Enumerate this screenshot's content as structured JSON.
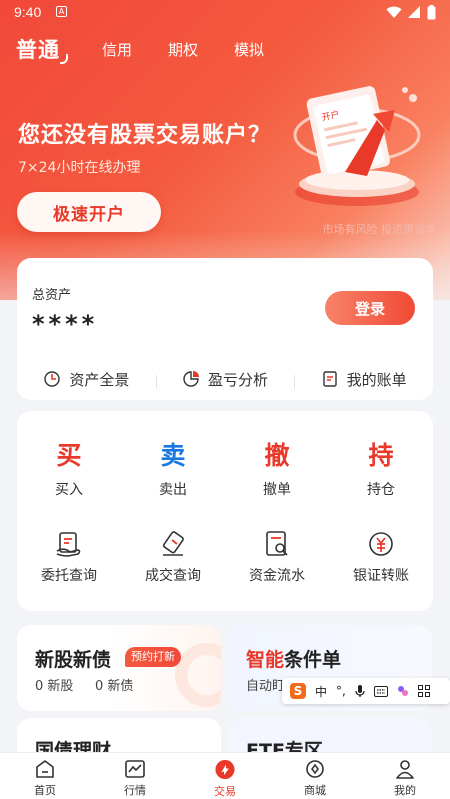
{
  "status_bar": {
    "time": "9:40",
    "notification_badge": "A"
  },
  "top_tabs": {
    "active": "普通",
    "others": [
      "信用",
      "期权",
      "模拟"
    ]
  },
  "hero": {
    "title": "您还没有股票交易账户？",
    "subtitle": "7×24小时在线办理",
    "open_button": "极速开户",
    "risk_note": "市场有风险 投资需谨慎",
    "illustration_text": "开户"
  },
  "asset_card": {
    "label": "总资产",
    "value": "****",
    "login_button": "登录",
    "links": [
      {
        "label": "资产全景",
        "icon": "asset-overview-icon"
      },
      {
        "label": "盈亏分析",
        "icon": "pie-chart-icon"
      },
      {
        "label": "我的账单",
        "icon": "bill-icon"
      }
    ]
  },
  "trade_ops": [
    {
      "char": "买",
      "label": "买入",
      "color": "#e8392a"
    },
    {
      "char": "卖",
      "label": "卖出",
      "color": "#1a78e0"
    },
    {
      "char": "撤",
      "label": "撤单",
      "color": "#e8392a"
    },
    {
      "char": "持",
      "label": "持仓",
      "color": "#e8392a"
    }
  ],
  "query_ops": [
    {
      "label": "委托查询",
      "icon": "entrust-query-icon"
    },
    {
      "label": "成交查询",
      "icon": "deal-query-icon"
    },
    {
      "label": "资金流水",
      "icon": "fund-flow-icon"
    },
    {
      "label": "银证转账",
      "icon": "bank-transfer-icon"
    }
  ],
  "promos": {
    "new_stock": {
      "title": "新股新债",
      "badge": "预约打新",
      "stock_count": "0 新股",
      "bond_count": "0 新债"
    },
    "condition_order": {
      "title_prefix": "智能",
      "title_suffix": "条件单",
      "subtitle": "自动盯盘 智能触发"
    },
    "treasury": {
      "title": "国债理财"
    },
    "etf": {
      "title": "ETF专区"
    }
  },
  "ime_bar": {
    "logo": "S",
    "lang": "中",
    "punct": "°,"
  },
  "bottom_nav": [
    {
      "label": "首页",
      "icon": "home-icon"
    },
    {
      "label": "行情",
      "icon": "market-chart-icon"
    },
    {
      "label": "交易",
      "icon": "trade-icon"
    },
    {
      "label": "商城",
      "icon": "mall-icon"
    },
    {
      "label": "我的",
      "icon": "profile-icon"
    }
  ],
  "colors": {
    "brand_red": "#e8392a",
    "sell_blue": "#1a78e0",
    "background": "#f3f4f8"
  }
}
